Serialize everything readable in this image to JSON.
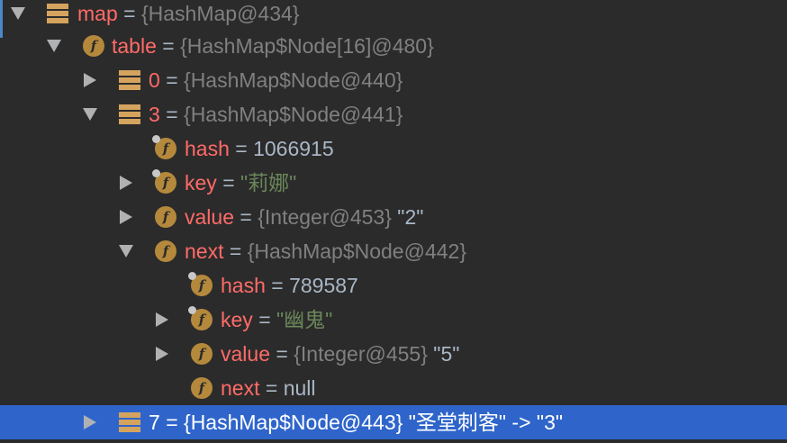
{
  "rows": [
    {
      "name": "map",
      "eq": "=",
      "value": "{HashMap@434}",
      "suffix": ""
    },
    {
      "name": "table",
      "eq": "=",
      "value": "{HashMap$Node[16]@480}",
      "suffix": ""
    },
    {
      "name": "0",
      "eq": "=",
      "value": "{HashMap$Node@440}",
      "suffix": ""
    },
    {
      "name": "3",
      "eq": "=",
      "value": "{HashMap$Node@441}",
      "suffix": ""
    },
    {
      "name": "hash",
      "eq": "=",
      "value": "1066915",
      "suffix": ""
    },
    {
      "name": "key",
      "eq": "=",
      "value": "\"莉娜\"",
      "suffix": ""
    },
    {
      "name": "value",
      "eq": "=",
      "value": "{Integer@453}",
      "suffix": "\"2\""
    },
    {
      "name": "next",
      "eq": "=",
      "value": "{HashMap$Node@442}",
      "suffix": ""
    },
    {
      "name": "hash",
      "eq": "=",
      "value": "789587",
      "suffix": ""
    },
    {
      "name": "key",
      "eq": "=",
      "value": "\"幽鬼\"",
      "suffix": ""
    },
    {
      "name": "value",
      "eq": "=",
      "value": "{Integer@455}",
      "suffix": "\"5\""
    },
    {
      "name": "next",
      "eq": "=",
      "value": "null",
      "suffix": ""
    },
    {
      "name": "7",
      "eq": "=",
      "value": "{HashMap$Node@443}",
      "suffix": "\"圣堂刺客\" -> \"3\""
    }
  ],
  "colors": {
    "background": "#2b2b2b",
    "selection": "#2f65ca",
    "field_name": "#ff6b68",
    "type_text": "#808080",
    "string_text": "#6a8759",
    "icon_amber": "#b5893c"
  },
  "icons": {
    "array": "array-stack-icon",
    "field": "field-f-icon",
    "expanded": "chevron-down-icon",
    "collapsed": "chevron-right-icon"
  }
}
